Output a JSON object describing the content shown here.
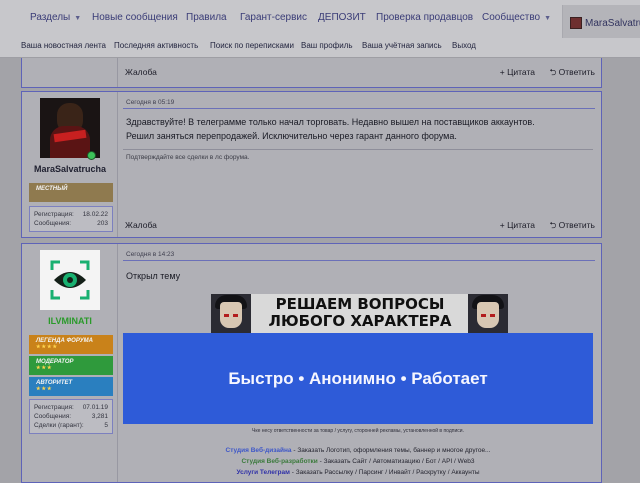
{
  "nav": {
    "items": [
      "Разделы",
      "Новые сообщения",
      "Правила",
      "Гарант-сервис",
      "ДЕПОЗИТ",
      "Проверка продавцов",
      "Сообщество"
    ],
    "username": "MaraSalvatrucha",
    "sub": [
      "Ваша новостная лента",
      "Последняя активность",
      "Поиск по переписками",
      "Ваш профиль",
      "Ваша учётная запись",
      "Выход"
    ]
  },
  "post0": {
    "report": "Жалоба",
    "quote": "+ Цитата",
    "reply": "⮌ Ответить"
  },
  "post1": {
    "author": "MaraSalvatrucha",
    "rank": "МЕСТНЫЙ",
    "stats": [
      {
        "label": "Регистрация:",
        "value": "18.02.22"
      },
      {
        "label": "Сообщения:",
        "value": "203"
      }
    ],
    "timestamp": "Сегодня в 05:19",
    "message_line1": "Здравствуйте! В телеграмме только начал торговать. Недавно вышел на поставщиков аккаунтов.",
    "message_line2": "Решил заняться перепродажей. Исключительно через гарант данного форума.",
    "signature": "Подтверждайте все сделки в лс форума.",
    "report": "Жалоба",
    "quote": "+ Цитата",
    "reply": "⮌ Ответить"
  },
  "post2": {
    "author": "ILVMINATI",
    "ranks": [
      {
        "label": "ЛЕГЕНДА ФОРУМА",
        "stars": "★★★★",
        "color": "#c9821a"
      },
      {
        "label": "МОДЕРАТОР",
        "stars": "★★★",
        "color": "#2f9a3c"
      },
      {
        "label": "АВТОРИТЕТ",
        "stars": "★★★",
        "color": "#2a7fbf"
      }
    ],
    "stats": [
      {
        "label": "Регистрация:",
        "value": "07.01.19"
      },
      {
        "label": "Сообщения:",
        "value": "3,281"
      },
      {
        "label": "Сделки (гарант):",
        "value": "5"
      }
    ],
    "timestamp": "Сегодня в 14:23",
    "message": "Открыл тему",
    "banner1_line1": "РЕШАЕМ ВОПРОСЫ",
    "banner1_line2": "ЛЮБОГО ХАРАКТЕРА",
    "banner2": "Быстро • Анонимно • Работает",
    "disclaimer": "Чке несу ответственности за товар / услугу, сторонней рекламы, установленной в подписи.",
    "studio1_link": "Студия Веб-дизайна",
    "studio1_text": " - Заказать Логотип, оформления темы, баннер и многое другое...",
    "studio2_link": "Студия Веб-разработки",
    "studio2_text": " - Заказать Сайт / Автоматизацию / Бот / API / Web3",
    "studio3_link": "Услуги Телеграм",
    "studio3_text": " - Заказать Рассылку / Парсинг / Инвайт / Раскрутку / Аккаунты"
  },
  "colors": {
    "accent": "#5e63b8",
    "banner": "#2e5bd8",
    "online": "#3cc35a"
  }
}
